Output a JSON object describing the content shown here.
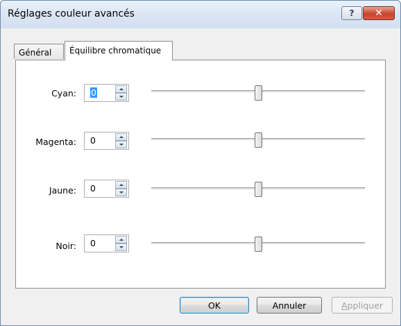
{
  "window": {
    "title": "Réglages couleur avancés",
    "help_label": "?",
    "close_label": "✕"
  },
  "tabs": [
    {
      "label": "Général",
      "selected": false
    },
    {
      "label": "Équilibre chromatique",
      "selected": true
    }
  ],
  "rows": [
    {
      "label": "Cyan:",
      "value": "0",
      "slider_fraction": 0.5,
      "focused": true
    },
    {
      "label": "Magenta:",
      "value": "0",
      "slider_fraction": 0.5,
      "focused": false
    },
    {
      "label": "Jaune:",
      "value": "0",
      "slider_fraction": 0.5,
      "focused": false
    },
    {
      "label": "Noir:",
      "value": "0",
      "slider_fraction": 0.5,
      "focused": false
    }
  ],
  "buttons": {
    "ok": "OK",
    "cancel": "Annuler",
    "apply_first": "A",
    "apply_rest": "ppliquer",
    "apply_enabled": false
  },
  "colors": {
    "selection": "#3399ff",
    "title_gradient_top": "#e9f1fb",
    "close_red": "#c8452e"
  }
}
